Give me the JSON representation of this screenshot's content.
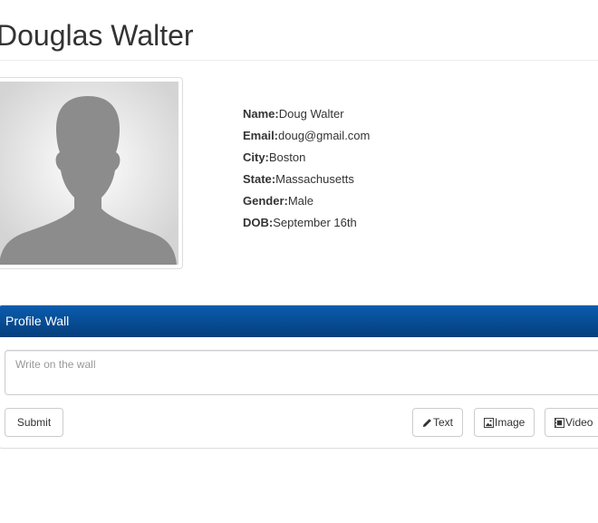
{
  "profile": {
    "display_name": "Douglas Walter",
    "fields": [
      {
        "label": "Name:",
        "value": "Doug Walter"
      },
      {
        "label": "Email:",
        "value": "doug@gmail.com"
      },
      {
        "label": "City:",
        "value": "Boston"
      },
      {
        "label": "State:",
        "value": "Massachusetts"
      },
      {
        "label": "Gender:",
        "value": "Male"
      },
      {
        "label": "DOB:",
        "value": "September 16th"
      }
    ]
  },
  "wall": {
    "heading": "Profile Wall",
    "input_placeholder": "Write on the wall",
    "submit_label": "Submit",
    "text_label": "Text",
    "image_label": "Image",
    "video_label": "Video",
    "heading_color": "#0a5cae"
  },
  "icons": {
    "avatar": "person-silhouette-icon",
    "text": "pencil-icon",
    "image": "picture-icon",
    "video": "film-icon"
  }
}
